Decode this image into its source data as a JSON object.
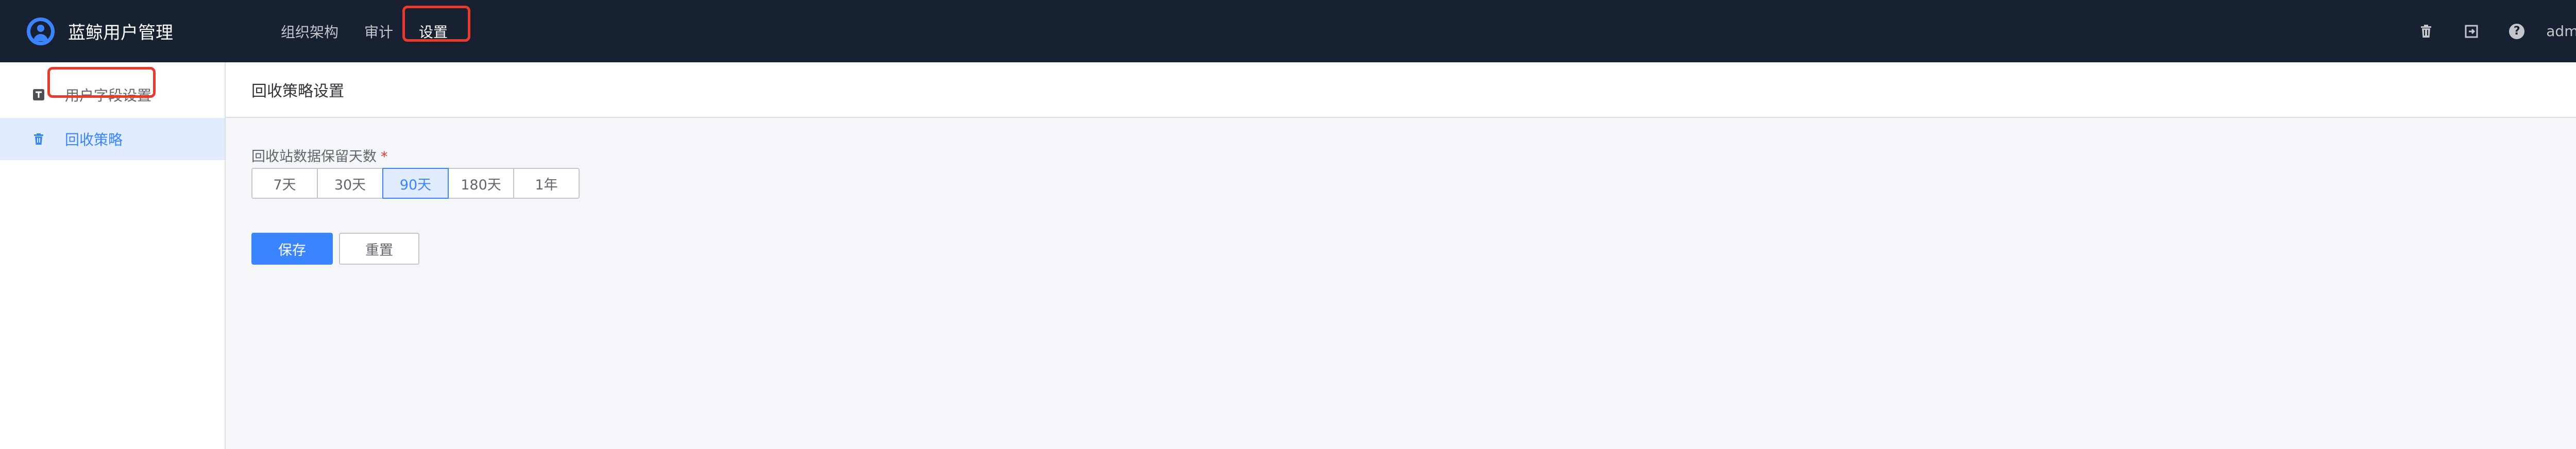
{
  "app": {
    "title": "蓝鲸用户管理"
  },
  "nav": {
    "items": [
      {
        "label": "组织架构"
      },
      {
        "label": "审计"
      },
      {
        "label": "设置"
      }
    ]
  },
  "header_right": {
    "user": "admin"
  },
  "sidebar": {
    "items": [
      {
        "label": "用户字段设置"
      },
      {
        "label": "回收策略"
      }
    ]
  },
  "main": {
    "title": "回收策略设置",
    "field_label": "回收站数据保留天数",
    "required_mark": "*",
    "options": [
      "7天",
      "30天",
      "90天",
      "180天",
      "1年"
    ],
    "selected_option": "90天",
    "save_label": "保存",
    "reset_label": "重置"
  },
  "colors": {
    "topbar": "#182132",
    "accent": "#3a84ff",
    "highlight_box": "#e93a2c"
  },
  "icons": {
    "brand": "user-circle-icon",
    "recycle_bin": "trash-icon",
    "export": "export-icon",
    "help": "help-icon",
    "user_field": "text-field-icon",
    "recycle_policy": "trash-icon"
  }
}
